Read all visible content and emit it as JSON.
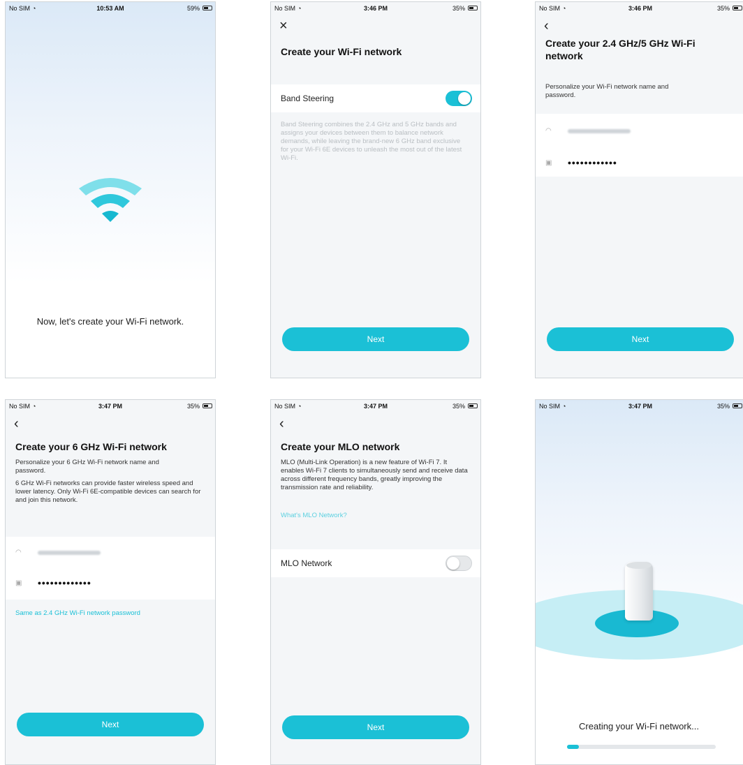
{
  "colors": {
    "accent": "#1bc0d6",
    "background": "#f4f6f8",
    "text": "#1a1a1a"
  },
  "screens": {
    "s1": {
      "status": {
        "carrier": "No SIM",
        "time": "10:53 AM",
        "battery": "59%"
      },
      "message": "Now, let's create your Wi-Fi network.",
      "icon": "wifi-large-icon"
    },
    "s2": {
      "status": {
        "carrier": "No SIM",
        "time": "3:46 PM",
        "battery": "35%"
      },
      "close_icon": "×",
      "title": "Create your Wi-Fi network",
      "band_steering_label": "Band Steering",
      "band_steering_on": true,
      "description": "Band Steering combines the 2.4 GHz and 5 GHz bands and assigns your devices between them to balance network demands, while leaving the brand-new 6 GHz band exclusive for your Wi-Fi 6E devices to unleash the most out of the latest Wi-Fi.",
      "next_label": "Next"
    },
    "s3": {
      "status": {
        "carrier": "No SIM",
        "time": "3:46 PM",
        "battery": "35%"
      },
      "back_icon": "‹",
      "title": "Create your 2.4 GHz/5 GHz Wi-Fi network",
      "description": "Personalize your Wi-Fi network name and password.",
      "password_mask": "••••••••••••",
      "next_label": "Next"
    },
    "s4": {
      "status": {
        "carrier": "No SIM",
        "time": "3:47 PM",
        "battery": "35%"
      },
      "back_icon": "‹",
      "title": "Create your 6 GHz Wi-Fi network",
      "description1": "Personalize your 6 GHz Wi-Fi network name and password.",
      "description2": "6 GHz Wi-Fi networks can provide faster wireless speed and lower latency. Only Wi-Fi 6E-compatible devices can search for and join this network.",
      "password_mask": "•••••••••••••",
      "same_link": "Same as 2.4 GHz Wi-Fi network password",
      "next_label": "Next"
    },
    "s5": {
      "status": {
        "carrier": "No SIM",
        "time": "3:47 PM",
        "battery": "35%"
      },
      "back_icon": "‹",
      "title": "Create your MLO network",
      "description": "MLO (Multi-Link Operation) is a new feature of Wi-Fi 7. It enables Wi-Fi 7 clients to simultaneously send and receive data across different frequency bands, greatly improving the transmission rate and reliability.",
      "what_link": "What's MLO Network?",
      "mlo_label": "MLO Network",
      "mlo_on": false,
      "next_label": "Next"
    },
    "s6": {
      "status": {
        "carrier": "No SIM",
        "time": "3:47 PM",
        "battery": "35%"
      },
      "message": "Creating your Wi-Fi network...",
      "progress": 0.08
    }
  }
}
